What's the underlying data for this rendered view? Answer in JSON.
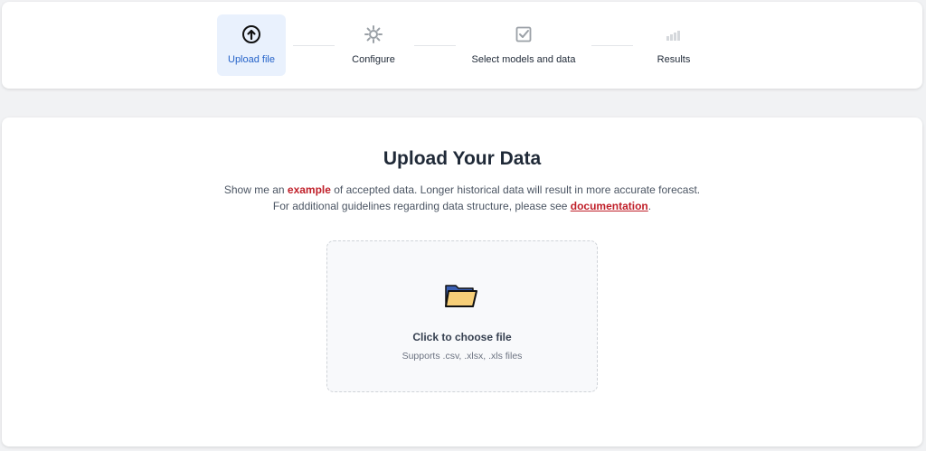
{
  "stepper": {
    "steps": [
      {
        "label": "Upload file",
        "icon": "upload-circle-icon",
        "active": true
      },
      {
        "label": "Configure",
        "icon": "gear-icon",
        "active": false
      },
      {
        "label": "Select models and data",
        "icon": "checkbox-icon",
        "active": false
      },
      {
        "label": "Results",
        "icon": "bar-chart-icon",
        "active": false
      }
    ]
  },
  "main": {
    "title": "Upload Your Data",
    "desc_prefix": "Show me an ",
    "example_link": "example",
    "desc_mid": " of accepted data. Longer historical data will result in more accurate forecast.",
    "desc_line2": "For additional guidelines regarding data structure, please see ",
    "documentation_link": "documentation",
    "desc_suffix": "."
  },
  "dropzone": {
    "icon": "folder-icon",
    "title": "Click to choose file",
    "subtitle": "Supports .csv, .xlsx, .xls files"
  },
  "colors": {
    "accent": "#2563c9",
    "active_bg": "#e9f1fd",
    "link": "#c0202a",
    "folder_fill": "#f7cf78"
  }
}
